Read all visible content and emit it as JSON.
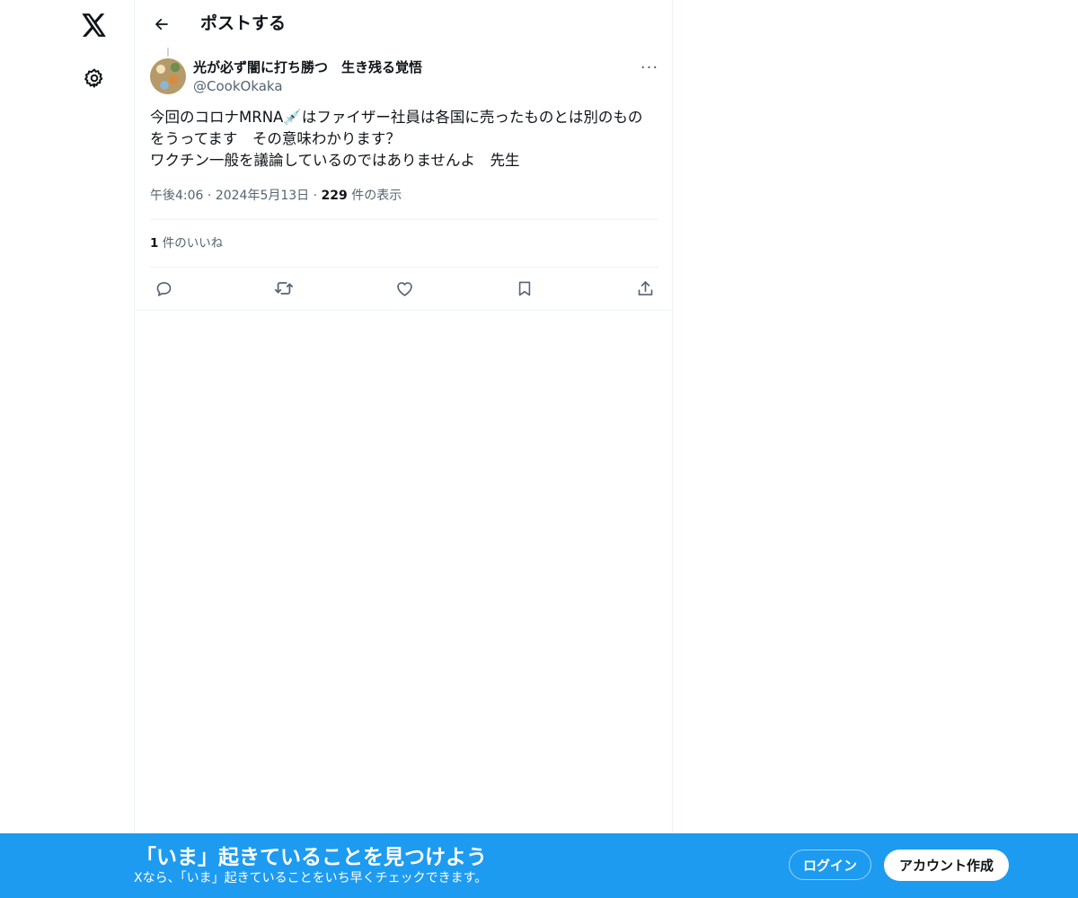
{
  "nav": {
    "logo_icon": "x-logo-icon",
    "settings_icon": "gear-icon"
  },
  "header": {
    "back_icon": "arrow-left-icon",
    "title": "ポストする"
  },
  "post": {
    "display_name": "光が必ず闇に打ち勝つ　生き残る覚悟",
    "handle": "@CookOkaka",
    "more_label": "···",
    "text_lines": [
      "今回のコロナMRNA💉はファイザー社員は各国に売ったものとは別のもの",
      "をうってます　その意味わかります？",
      "ワクチン一般を議論しているのではありませんよ　先生"
    ],
    "time": "午後4:06",
    "separator": "·",
    "date": "2024年5月13日",
    "views_count": "229",
    "views_label": " 件の表示",
    "likes_count": "1",
    "likes_label": " 件のいいね",
    "actions": [
      "reply-icon",
      "repost-icon",
      "like-icon",
      "bookmark-icon",
      "share-icon"
    ]
  },
  "banner": {
    "title": "「いま」起きていることを見つけよう",
    "subtitle": "Xなら、「いま」起きていることをいち早くチェックできます。",
    "login_label": "ログイン",
    "signup_label": "アカウント作成",
    "background_color": "#1d9bf0"
  }
}
